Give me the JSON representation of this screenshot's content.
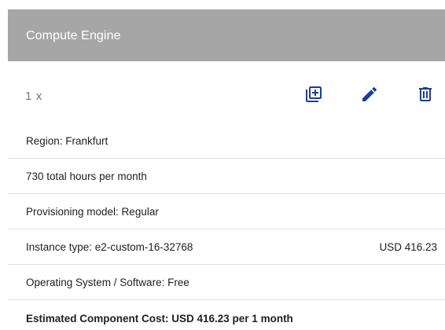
{
  "card": {
    "title": "Compute Engine",
    "quantity": "1 x",
    "icons": {
      "duplicate": "library-add-icon",
      "edit": "pencil-icon",
      "delete": "trash-icon"
    },
    "accent_color": "#1a3e9b",
    "header_color": "#a6a6a6"
  },
  "details": [
    {
      "label": "Region: Frankfurt",
      "price": ""
    },
    {
      "label": "730 total hours per month",
      "price": ""
    },
    {
      "label": "Provisioning model: Regular",
      "price": ""
    },
    {
      "label": "Instance type: e2-custom-16-32768",
      "price": "USD 416.23"
    },
    {
      "label": "Operating System / Software: Free",
      "price": ""
    }
  ],
  "total": "Estimated Component Cost: USD 416.23 per 1 month"
}
